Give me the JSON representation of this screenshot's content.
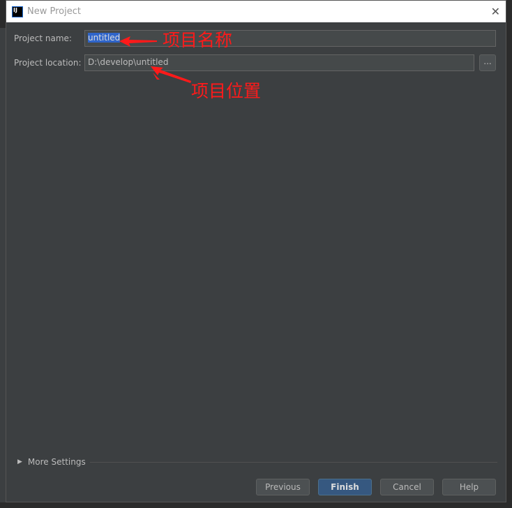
{
  "dialog": {
    "title": "New Project",
    "app_icon": "IJ",
    "close": "✕"
  },
  "form": {
    "name_label": "Project name:",
    "name_value": "untitled",
    "location_label": "Project location:",
    "location_value": "D:\\develop\\untitled",
    "browse_label": "..."
  },
  "annotations": {
    "name_note": "项目名称",
    "location_note": "项目位置",
    "color": "#ff1a1a"
  },
  "more_settings": "More Settings",
  "buttons": {
    "previous": "Previous",
    "finish": "Finish",
    "cancel": "Cancel",
    "help": "Help"
  }
}
